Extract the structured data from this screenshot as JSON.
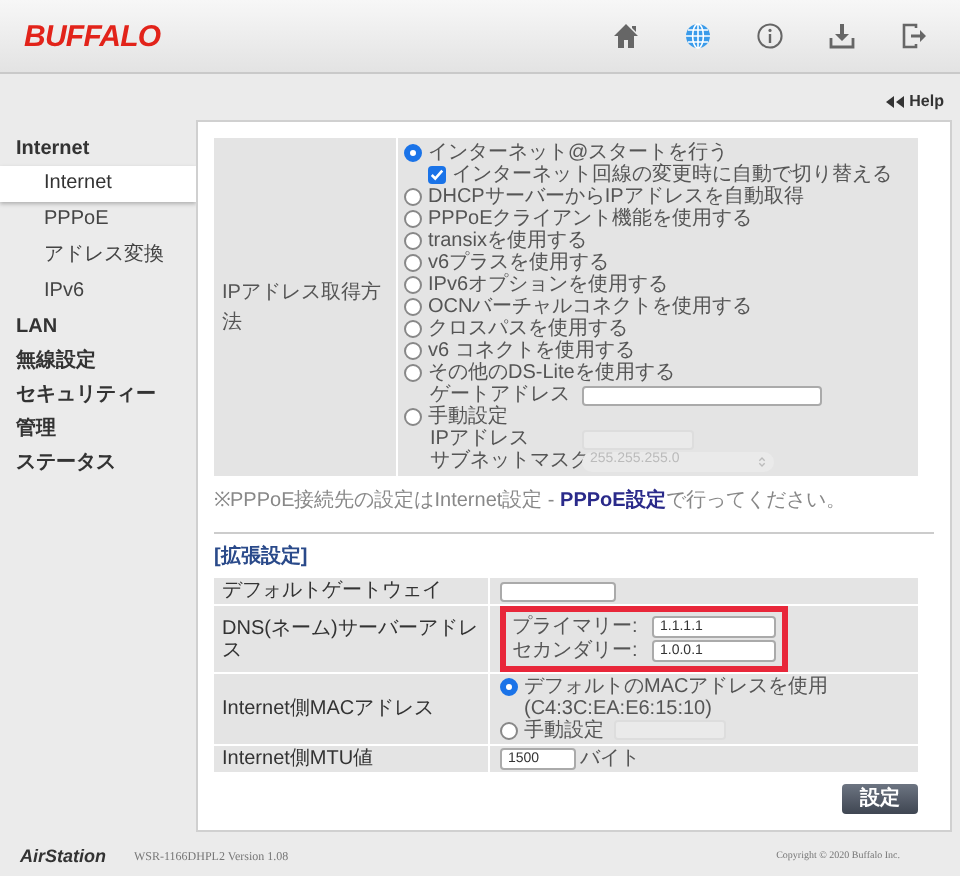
{
  "header": {
    "logo": "BUFFALO",
    "nav": [
      {
        "kind": "home",
        "selected": false
      },
      {
        "kind": "globe",
        "selected": true
      },
      {
        "kind": "info",
        "selected": false
      },
      {
        "kind": "download",
        "selected": false
      },
      {
        "kind": "logout",
        "selected": false
      }
    ]
  },
  "help": {
    "label": "Help"
  },
  "sidebar": {
    "items": [
      {
        "label": "Internet",
        "selected": false,
        "children": [
          {
            "label": "Internet",
            "selected": true
          },
          {
            "label": "PPPoE",
            "selected": false
          },
          {
            "label": "アドレス変換",
            "selected": false
          },
          {
            "label": "IPv6",
            "selected": false
          }
        ]
      },
      {
        "label": "LAN",
        "selected": false
      },
      {
        "label": "無線設定",
        "selected": false
      },
      {
        "label": "セキュリティー",
        "selected": false
      },
      {
        "label": "管理",
        "selected": false
      },
      {
        "label": "ステータス",
        "selected": false
      }
    ]
  },
  "ip_method": {
    "label": "IPアドレス取得方法",
    "options": [
      {
        "kind": "radio",
        "label": "インターネット@スタートを行う",
        "selected": true
      },
      {
        "kind": "checkbox",
        "label": "インターネット回線の変更時に自動で切り替える",
        "checked": true
      },
      {
        "kind": "radio",
        "label": "DHCPサーバーからIPアドレスを自動取得",
        "selected": false
      },
      {
        "kind": "radio",
        "label": "PPPoEクライアント機能を使用する",
        "selected": false
      },
      {
        "kind": "radio",
        "label": "transixを使用する",
        "selected": false
      },
      {
        "kind": "radio",
        "label": "v6プラスを使用する",
        "selected": false
      },
      {
        "kind": "radio",
        "label": "IPv6オプションを使用する",
        "selected": false
      },
      {
        "kind": "radio",
        "label": "OCNバーチャルコネクトを使用する",
        "selected": false
      },
      {
        "kind": "radio",
        "label": "クロスパスを使用する",
        "selected": false
      },
      {
        "kind": "radio",
        "label": "v6 コネクトを使用する",
        "selected": false
      },
      {
        "kind": "radio",
        "label": "その他のDS-Liteを使用する",
        "selected": false,
        "fields": [
          {
            "kind": "input",
            "label": "ゲートアドレス",
            "disabled": false
          }
        ]
      },
      {
        "kind": "radio",
        "label": "手動設定",
        "selected": false,
        "fields": [
          {
            "kind": "input",
            "label": "IPアドレス",
            "disabled": true
          },
          {
            "kind": "select",
            "label": "サブネットマスク",
            "value": "255.255.255.0",
            "disabled": true
          }
        ]
      }
    ]
  },
  "note": {
    "before": "※PPPoE接続先の設定はInternet設定 - ",
    "link": "PPPoE設定",
    "after": "で行ってください。"
  },
  "advanced": {
    "title": "[拡張設定]",
    "rows": [
      {
        "kind": "input",
        "label": "デフォルトゲートウェイ"
      },
      {
        "kind": "dns",
        "label": "DNS(ネーム)サーバーアドレス",
        "highlighted": true,
        "fields": [
          {
            "label": "プライマリー:",
            "value": "1.1.1.1"
          },
          {
            "label": "セカンダリー:",
            "value": "1.0.0.1"
          }
        ]
      },
      {
        "kind": "mac",
        "label": "Internet側MACアドレス",
        "options": [
          {
            "label": "デフォルトのMACアドレスを使用 (C4:3C:EA:E6:15:10)",
            "selected": true
          },
          {
            "label": "手動設定",
            "selected": false
          }
        ]
      },
      {
        "kind": "mtu",
        "label": "Internet側MTU値",
        "value": "1500",
        "unit": "バイト"
      }
    ]
  },
  "submit": "設定",
  "footer": {
    "brand": "AirStation",
    "model": "WSR-1166DHPL2 Version 1.08",
    "copyright": "Copyright © 2020 Buffalo Inc."
  }
}
